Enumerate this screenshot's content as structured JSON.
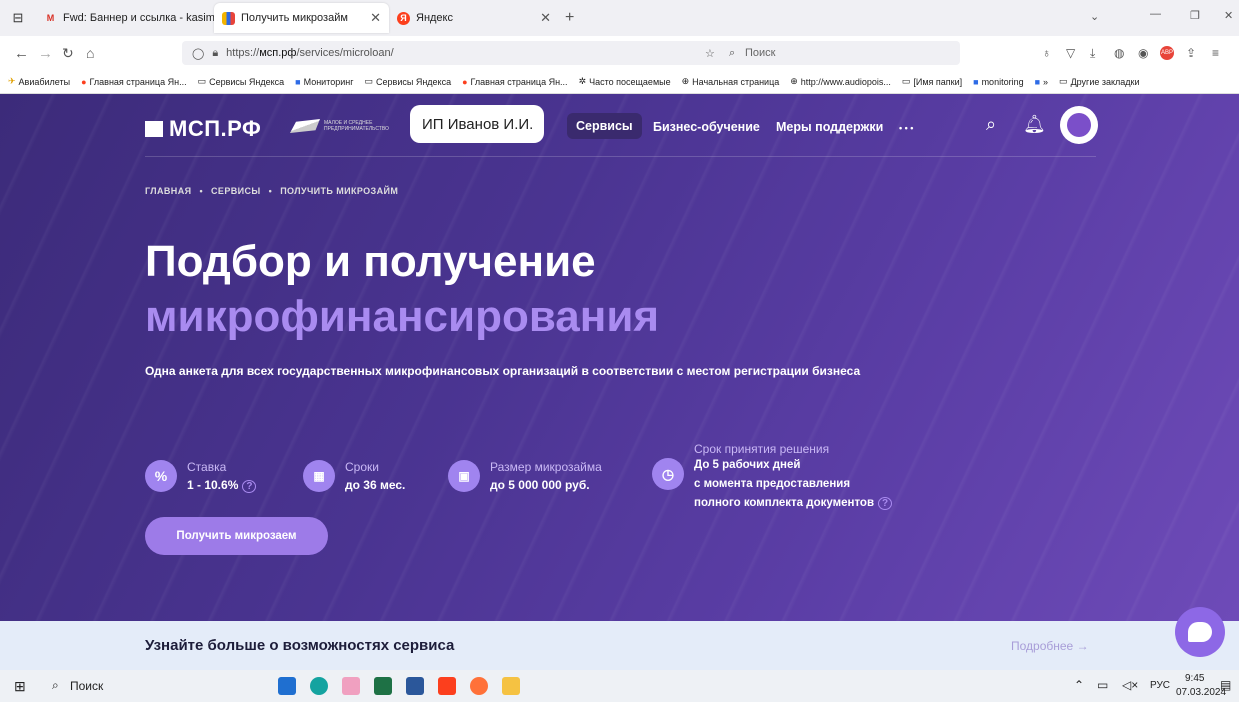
{
  "tabs": [
    {
      "label": "Fwd: Баннер и ссылка - kasim",
      "icon": "gmail-icon",
      "color": "#d93025",
      "glyph": "M"
    },
    {
      "label": "Получить микрозайм",
      "icon": "msp-bars-icon",
      "color": "#2e6be6",
      "glyph": "▮"
    },
    {
      "label": "Яндекс",
      "icon": "yandex-icon",
      "color": "#fc3f1d",
      "glyph": "Я"
    }
  ],
  "address": {
    "url_prefix": "https://",
    "url_host": "мсп.рф",
    "url_path": "/services/microloan/",
    "search_placeholder": "Поиск"
  },
  "bookmarks": [
    "Авиабилеты",
    "Главная страница Ян...",
    "Сервисы Яндекса",
    "Мониторинг",
    "Сервисы Яндекса",
    "Главная страница Ян...",
    "Часто посещаемые",
    "Начальная страница",
    "http://www.audiopois...",
    "[Имя папки]",
    "monitoring",
    "Другие закладки"
  ],
  "site": {
    "logo": "МСП.РФ",
    "tagline": "МАЛОЕ И СРЕДНЕЕ ПРЕДПРИНИМАТЕЛЬСТВО",
    "user": "ИП Иванов И.И.",
    "nav": [
      "Сервисы",
      "Бизнес-обучение",
      "Меры поддержки",
      "• • •"
    ]
  },
  "breadcrumb": [
    "ГЛАВНАЯ",
    "СЕРВИСЫ",
    "ПОЛУЧИТЬ МИКРОЗАЙМ"
  ],
  "hero": {
    "title_line1": "Подбор и получение",
    "title_line2": "микрофинансирования",
    "subtitle": "Одна анкета для всех государственных микрофинансовых организаций в соответствии с местом регистрации бизнеса"
  },
  "features": [
    {
      "icon": "percent-icon",
      "glyph": "%",
      "label": "Ставка",
      "value": "1 - 10.6%"
    },
    {
      "icon": "calendar-icon",
      "glyph": "▦",
      "label": "Сроки",
      "value": "до 36 мес."
    },
    {
      "icon": "wallet-icon",
      "glyph": "▣",
      "label": "Размер микрозайма",
      "value": "до 5 000 000 руб."
    },
    {
      "icon": "clock-icon",
      "glyph": "◷",
      "label": "Срок принятия решения",
      "line1": "До 5 рабочих дней",
      "line2": "с момента предоставления",
      "line3": "полного комплекта документов"
    }
  ],
  "cta": "Получить микрозаем",
  "info_bar": {
    "title": "Узнайте больше о возможностях сервиса",
    "more": "Подробнее →"
  },
  "taskbar": {
    "search": "Поиск",
    "lang": "РУС",
    "time": "9:45",
    "date": "07.03.2024"
  },
  "colors": {
    "hero": "#4a3491",
    "accent": "#a98bf0",
    "button": "#9d7be8",
    "info": "#e4ecf9"
  }
}
